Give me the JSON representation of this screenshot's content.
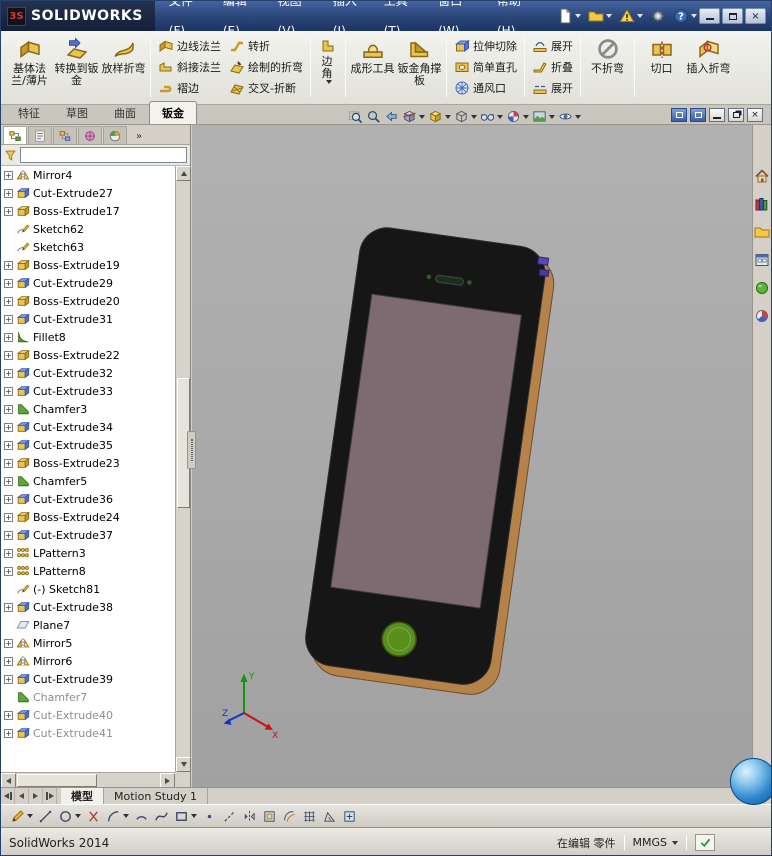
{
  "colors": {
    "titlebar_top": "#44639f",
    "titlebar_bottom": "#1c3464",
    "viewport_bg": "#a9a9a9",
    "phone_body": "#161616",
    "phone_screen": "#7e6a71",
    "phone_edge": "#b5834a",
    "home_button": "#5a8f1e",
    "triad_x": "#cc1111",
    "triad_y": "#119911",
    "triad_z": "#1133cc"
  },
  "titlebar": {
    "logo_badge": "3S",
    "app_name": "SOLIDWORKS",
    "menus": [
      "文件(F)",
      "编辑(E)",
      "视图(V)",
      "插入(I)",
      "工具(T)",
      "窗口(W)",
      "帮助(H)"
    ],
    "quick_tools": [
      {
        "name": "new-document",
        "dropdown": true
      },
      {
        "name": "open-document",
        "dropdown": true
      },
      {
        "name": "rebuild",
        "dropdown": true
      },
      {
        "name": "options",
        "dropdown": false
      },
      {
        "name": "help",
        "dropdown": true
      }
    ],
    "window_buttons": [
      "minimize",
      "maximize",
      "close"
    ]
  },
  "ribbon": {
    "groups": [
      {
        "layout": "big",
        "items": [
          {
            "label": "基体法兰/薄片",
            "icon": "base-flange"
          },
          {
            "label": "转换到钣金",
            "icon": "convert-to-sheet-metal"
          },
          {
            "label": "放样折弯",
            "icon": "lofted-bend"
          }
        ]
      },
      {
        "layout": "grid",
        "items": [
          {
            "label": "边线法兰",
            "icon": "edge-flange"
          },
          {
            "label": "斜接法兰",
            "icon": "miter-flange"
          },
          {
            "label": "褶边",
            "icon": "hem"
          },
          {
            "label": "转折",
            "icon": "jog"
          },
          {
            "label": "绘制的折弯",
            "icon": "sketched-bend"
          },
          {
            "label": "交叉-折断",
            "icon": "cross-break"
          }
        ]
      },
      {
        "layout": "narrow",
        "items": [
          {
            "label": "边角",
            "icon": "corners",
            "dropdown": true
          }
        ]
      },
      {
        "layout": "big",
        "items": [
          {
            "label": "成形工具",
            "icon": "forming-tool"
          },
          {
            "label": "钣金角撑板",
            "icon": "sheet-metal-gusset"
          }
        ]
      },
      {
        "layout": "column",
        "items": [
          {
            "label": "拉伸切除",
            "icon": "extruded-cut"
          },
          {
            "label": "简单直孔",
            "icon": "simple-hole"
          },
          {
            "label": "通风口",
            "icon": "vent"
          }
        ]
      },
      {
        "layout": "column",
        "items": [
          {
            "label": "展开",
            "icon": "unfold"
          },
          {
            "label": "折叠",
            "icon": "fold"
          },
          {
            "label": "展开",
            "icon": "flatten"
          }
        ]
      },
      {
        "layout": "big",
        "items": [
          {
            "label": "不折弯",
            "icon": "no-bends"
          }
        ]
      },
      {
        "layout": "big",
        "items": [
          {
            "label": "切口",
            "icon": "rip"
          },
          {
            "label": "插入折弯",
            "icon": "insert-bends"
          }
        ]
      }
    ]
  },
  "command_tabs": {
    "items": [
      "特征",
      "草图",
      "曲面",
      "钣金"
    ],
    "active_index": 3
  },
  "headsup_toolbar": [
    {
      "name": "zoom-fit",
      "dropdown": false
    },
    {
      "name": "zoom-area",
      "dropdown": false
    },
    {
      "name": "previous-view",
      "dropdown": false
    },
    {
      "name": "section-view",
      "dropdown": true
    },
    {
      "name": "view-orientation",
      "dropdown": true
    },
    {
      "name": "display-style",
      "dropdown": true
    },
    {
      "name": "hide-show-items",
      "dropdown": true
    },
    {
      "name": "edit-appearance",
      "dropdown": true
    },
    {
      "name": "apply-scene",
      "dropdown": true
    },
    {
      "name": "view-settings",
      "dropdown": true
    }
  ],
  "doc_controls": [
    "window-previous",
    "window-next",
    "doc-minimize",
    "doc-restore",
    "doc-close"
  ],
  "feature_tree": {
    "panel_tabs": [
      "feature-manager",
      "property-manager",
      "configuration-manager",
      "dimxpert-manager",
      "display-manager"
    ],
    "overflow_button": "»",
    "filter": {
      "value": "",
      "placeholder": ""
    },
    "items": [
      {
        "label": "Mirror4",
        "icon": "mirror",
        "expand": true
      },
      {
        "label": "Cut-Extrude27",
        "icon": "cut-extrude",
        "expand": true
      },
      {
        "label": "Boss-Extrude17",
        "icon": "boss-extrude",
        "expand": true
      },
      {
        "label": "Sketch62",
        "icon": "sketch",
        "expand": false
      },
      {
        "label": "Sketch63",
        "icon": "sketch",
        "expand": false
      },
      {
        "label": "Boss-Extrude19",
        "icon": "boss-extrude",
        "expand": true
      },
      {
        "label": "Cut-Extrude29",
        "icon": "cut-extrude",
        "expand": true
      },
      {
        "label": "Boss-Extrude20",
        "icon": "boss-extrude",
        "expand": true
      },
      {
        "label": "Cut-Extrude31",
        "icon": "cut-extrude",
        "expand": true
      },
      {
        "label": "Fillet8",
        "icon": "fillet",
        "expand": true
      },
      {
        "label": "Boss-Extrude22",
        "icon": "boss-extrude",
        "expand": true
      },
      {
        "label": "Cut-Extrude32",
        "icon": "cut-extrude",
        "expand": true
      },
      {
        "label": "Cut-Extrude33",
        "icon": "cut-extrude",
        "expand": true
      },
      {
        "label": "Chamfer3",
        "icon": "chamfer",
        "expand": true
      },
      {
        "label": "Cut-Extrude34",
        "icon": "cut-extrude",
        "expand": true
      },
      {
        "label": "Cut-Extrude35",
        "icon": "cut-extrude",
        "expand": true
      },
      {
        "label": "Boss-Extrude23",
        "icon": "boss-extrude",
        "expand": true
      },
      {
        "label": "Chamfer5",
        "icon": "chamfer",
        "expand": true
      },
      {
        "label": "Cut-Extrude36",
        "icon": "cut-extrude",
        "expand": true
      },
      {
        "label": "Boss-Extrude24",
        "icon": "boss-extrude",
        "expand": true
      },
      {
        "label": "Cut-Extrude37",
        "icon": "cut-extrude",
        "expand": true
      },
      {
        "label": "LPattern3",
        "icon": "lpattern",
        "expand": true
      },
      {
        "label": "LPattern8",
        "icon": "lpattern",
        "expand": true
      },
      {
        "label": "(-) Sketch81",
        "icon": "sketch",
        "expand": false
      },
      {
        "label": "Cut-Extrude38",
        "icon": "cut-extrude",
        "expand": true
      },
      {
        "label": "Plane7",
        "icon": "plane",
        "expand": false
      },
      {
        "label": "Mirror5",
        "icon": "mirror",
        "expand": true
      },
      {
        "label": "Mirror6",
        "icon": "mirror",
        "expand": true
      },
      {
        "label": "Cut-Extrude39",
        "icon": "cut-extrude",
        "expand": true
      },
      {
        "label": "Chamfer7",
        "icon": "chamfer",
        "expand": false,
        "muted": true
      },
      {
        "label": "Cut-Extrude40",
        "icon": "cut-extrude",
        "expand": true,
        "muted": true
      },
      {
        "label": "Cut-Extrude41",
        "icon": "cut-extrude",
        "expand": true,
        "muted": true
      }
    ]
  },
  "viewport": {
    "triad": {
      "x": "X",
      "y": "Y",
      "z": "Z"
    }
  },
  "task_pane": [
    "solidworks-resources",
    "design-library",
    "file-explorer",
    "view-palette",
    "appearances-scenes",
    "custom-properties"
  ],
  "bottom_bar": {
    "nav": [
      "first",
      "previous",
      "next",
      "last"
    ],
    "tabs": [
      "模型",
      "Motion Study 1"
    ],
    "active_index": 0
  },
  "sketch_toolbar": [
    {
      "name": "sketch-tool",
      "dropdown": true
    },
    {
      "name": "line",
      "dropdown": false
    },
    {
      "name": "circle",
      "dropdown": true
    },
    {
      "name": "trim-entities",
      "dropdown": false
    },
    {
      "name": "centerpoint-arc",
      "dropdown": true
    },
    {
      "name": "tangent-arc",
      "dropdown": false
    },
    {
      "name": "spline",
      "dropdown": false
    },
    {
      "name": "corner-rectangle",
      "dropdown": true
    },
    {
      "name": "point",
      "dropdown": false
    },
    {
      "name": "centerline",
      "dropdown": false
    },
    {
      "name": "mirror-entities",
      "dropdown": false
    },
    {
      "name": "convert-entities",
      "dropdown": false
    },
    {
      "name": "offset-entities",
      "dropdown": false
    },
    {
      "name": "grid-system",
      "dropdown": false
    },
    {
      "name": "angle-dimension",
      "dropdown": false
    },
    {
      "name": "make-block",
      "dropdown": false
    }
  ],
  "status_bar": {
    "app_version": "SolidWorks 2014",
    "editing": "在编辑 零件",
    "units": "MMGS"
  }
}
